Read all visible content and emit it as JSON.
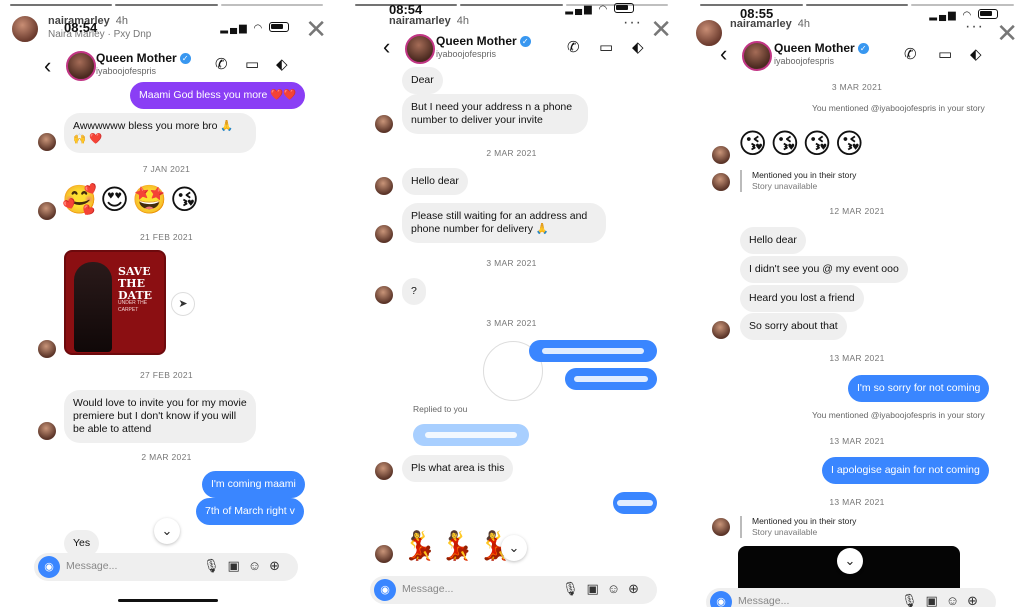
{
  "story": {
    "username": "nairamarley",
    "age": "4h",
    "song": "Naira Marley · Pxy Dnp",
    "times": [
      "08:54",
      "08:54",
      "08:55"
    ]
  },
  "chat": {
    "name": "Queen Mother",
    "handle": "iyaboojofespris",
    "composer_placeholder": "Message..."
  },
  "panel1": {
    "m1": "Maami God bless you more ❤️❤️",
    "m2": "Awwwwww bless you more bro 🙏 🙌 ❤️",
    "d1": "7 JAN 2021",
    "emojis": "🥰😍🤩😘",
    "d2": "21 FEB 2021",
    "poster_title": "SAVE THE DATE",
    "poster_sub": "UNDER THE CARPET",
    "d3": "27 FEB 2021",
    "m3": "Would love to invite you for my movie premiere but I don't know if you will be able to attend",
    "d4": "2 MAR 2021",
    "m4": "I'm coming maami",
    "m5": "7th of March right v",
    "m6": "Yes"
  },
  "panel2": {
    "m1": "Dear",
    "m2": "But I need your address n a phone number to deliver your invite",
    "d1": "2 MAR 2021",
    "m3": "Hello dear",
    "m4": "Please still waiting for an address and phone number for delivery 🙏",
    "d2": "3 MAR 2021",
    "m5": "?",
    "d3": "3 MAR 2021",
    "replied": "Replied to you",
    "m6": "Pls what area is this",
    "emojis": "💃💃💃"
  },
  "panel3": {
    "d1": "3 MAR 2021",
    "n1": "You mentioned @iyaboojofespris in your story",
    "emojis": "😘😘😘😘",
    "mention_title": "Mentioned you in their story",
    "mention_sub": "Story unavailable",
    "d2": "12 MAR 2021",
    "m1": "Hello dear",
    "m2": "I didn't see you @ my event ooo",
    "m3": "Heard you lost a friend",
    "m4": "So sorry about that",
    "d3": "13 MAR 2021",
    "m5": "I'm so sorry for not coming",
    "n2": "You mentioned @iyaboojofespris in your story",
    "d4": "13 MAR 2021",
    "m6": "I apologise again for not coming",
    "d5": "13 MAR 2021",
    "mention2_title": "Mentioned you in their story",
    "mention2_sub": "Story unavailable"
  },
  "colors": {
    "accent": "#3a86ff",
    "purple": "#8a3ef5",
    "bubble_in": "#efefef"
  },
  "icons": [
    "back-icon",
    "phone-icon",
    "video-icon",
    "tag-icon",
    "camera-icon",
    "mic-icon",
    "gallery-icon",
    "sticker-icon",
    "plus-icon",
    "close-icon",
    "more-icon",
    "share-icon",
    "chevron-down-icon",
    "verified-icon"
  ]
}
